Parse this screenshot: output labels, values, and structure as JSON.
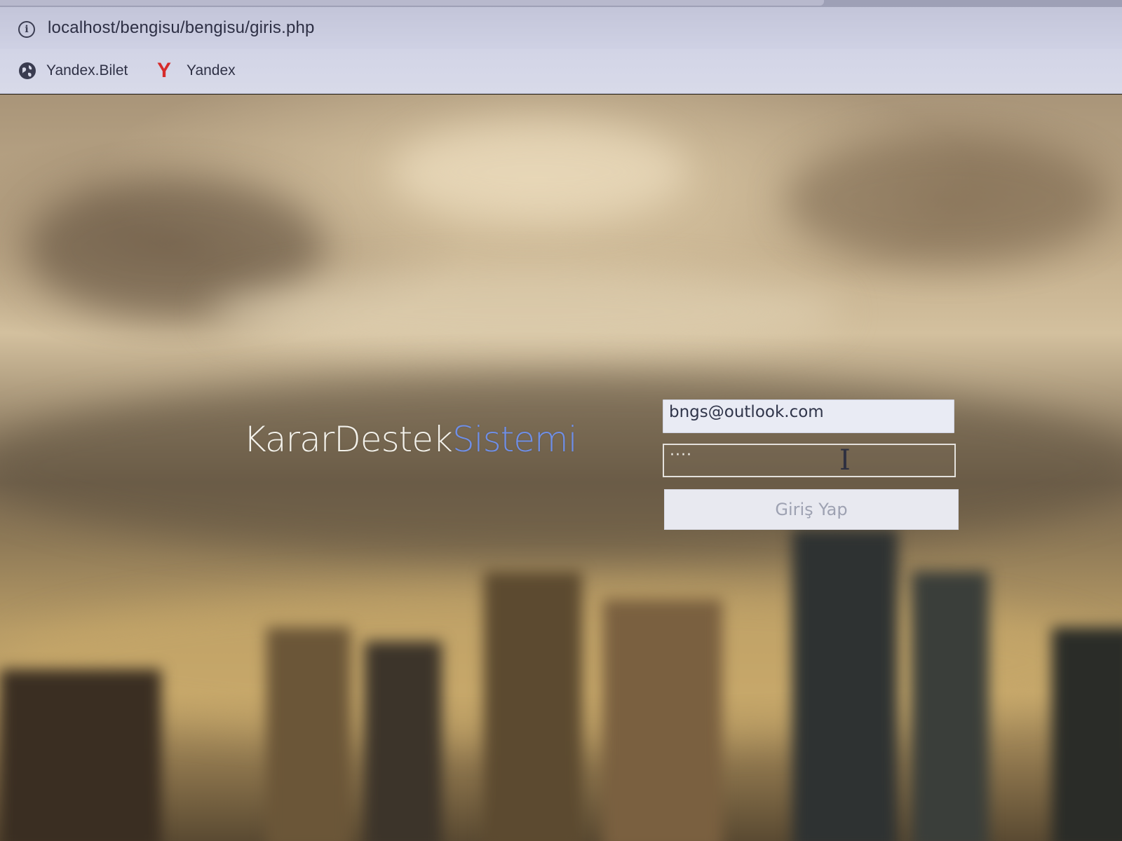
{
  "browser": {
    "url": "localhost/bengisu/bengisu/giris.php",
    "bookmarks": [
      {
        "label": "Yandex.Bilet",
        "icon": "globe-icon"
      },
      {
        "label": "Yandex",
        "icon": "yandex-icon"
      }
    ]
  },
  "login": {
    "brand_primary": "KararDestek",
    "brand_accent": "Sistemi",
    "email_value": "bngs@outlook.com",
    "password_masked": "····",
    "submit_label": "Giriş Yap"
  },
  "colors": {
    "brand_accent": "#6f8fe8",
    "brand_primary": "#f3f1ea",
    "bookmark_bar": "#d8dae9",
    "yandex_red": "#d62b2b"
  }
}
